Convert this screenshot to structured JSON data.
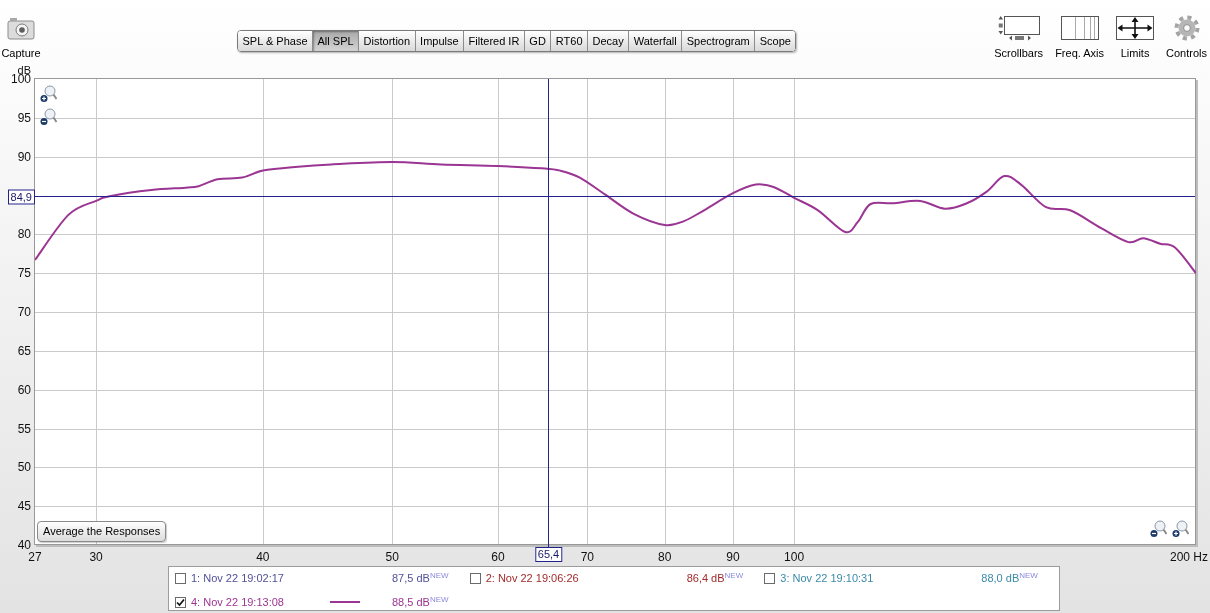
{
  "toolbar": {
    "capture": {
      "label": "Capture"
    },
    "tabs": [
      {
        "label": "SPL & Phase",
        "selected": false
      },
      {
        "label": "All SPL",
        "selected": true
      },
      {
        "label": "Distortion",
        "selected": false
      },
      {
        "label": "Impulse",
        "selected": false
      },
      {
        "label": "Filtered IR",
        "selected": false
      },
      {
        "label": "GD",
        "selected": false
      },
      {
        "label": "RT60",
        "selected": false
      },
      {
        "label": "Decay",
        "selected": false
      },
      {
        "label": "Waterfall",
        "selected": false
      },
      {
        "label": "Spectrogram",
        "selected": false
      },
      {
        "label": "Scope",
        "selected": false
      }
    ],
    "tools": [
      {
        "label": "Scrollbars",
        "kind": "scrollbars"
      },
      {
        "label": "Freq. Axis",
        "kind": "axis"
      },
      {
        "label": "Limits",
        "kind": "limits"
      },
      {
        "label": "Controls",
        "kind": "controls"
      }
    ]
  },
  "graph": {
    "chart_data": {
      "type": "line",
      "ylabel": "dB",
      "log": "x",
      "grid": true,
      "x": [
        27,
        28.6,
        30,
        30.7,
        33,
        35,
        35.8,
        37,
        38.6,
        40,
        42.5,
        45,
        50,
        54.4,
        60,
        64.7,
        66.8,
        69.1,
        72.2,
        75.9,
        80,
        82.7,
        85.6,
        90,
        93.6,
        96.5,
        100,
        104.2,
        109.2,
        111.6,
        114.1,
        118.5,
        124.3,
        129.7,
        134.7,
        139.4,
        143.7,
        147.9,
        154.4,
        161,
        169.8,
        178,
        182.6,
        188,
        192.9,
        200
      ],
      "series": [
        {
          "color": "#9b3593",
          "values": [
            76.7,
            82.5,
            84.3,
            84.9,
            85.7,
            86.0,
            86.2,
            87.1,
            87.3,
            88.2,
            88.7,
            89.0,
            89.3,
            89.0,
            88.8,
            88.5,
            88.2,
            87.3,
            85.1,
            82.6,
            81.2,
            81.7,
            83.1,
            85.3,
            86.4,
            86.1,
            84.7,
            83.1,
            80.3,
            81.6,
            83.9,
            84.0,
            84.3,
            83.3,
            84.0,
            85.5,
            87.5,
            86.4,
            83.5,
            83.1,
            80.8,
            79.0,
            79.5,
            78.8,
            78.3,
            75.0
          ]
        }
      ],
      "xlim": [
        27,
        200
      ],
      "ylim": [
        40,
        100
      ],
      "xticks": [
        27,
        30,
        40,
        50,
        60,
        70,
        80,
        90,
        100,
        {
          "value": 200,
          "label": "200 Hz"
        }
      ],
      "yticks": [
        40,
        45,
        50,
        55,
        60,
        65,
        70,
        75,
        80,
        90,
        95,
        100
      ],
      "ref_lines": [
        {
          "axis": "x",
          "value": 65.4,
          "label": "65,4"
        },
        {
          "axis": "y",
          "value": 84.9,
          "label": "84,9"
        }
      ]
    },
    "average_button": {
      "label": "Average the Responses"
    }
  },
  "legend": [
    {
      "label": "1: Nov 22 19:02:17",
      "value": "87,5 dB$^{NEW}$",
      "checked": false,
      "color": "#50509a"
    },
    {
      "label": "2: Nov 22 19:06:26",
      "value": "86,4 dB$^{NEW}$",
      "checked": false,
      "color": "#a32b2b"
    },
    {
      "label": "3: Nov 22 19:10:31",
      "value": "88,0 dB$^{NEW}$",
      "checked": false,
      "color": "#3a8aa8"
    },
    {
      "label": "4: Nov 22 19:13:08",
      "value": "88,5 dB$^{NEW}$",
      "checked": true,
      "color": "#9b3593"
    }
  ]
}
